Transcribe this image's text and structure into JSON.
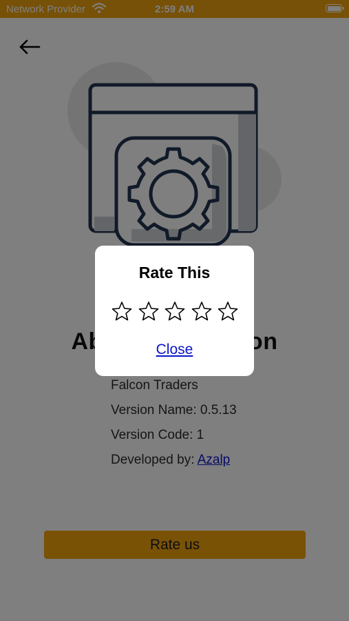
{
  "status_bar": {
    "carrier": "Network Provider",
    "time": "2:59 AM",
    "wifi_icon": "wifi-icon",
    "battery_icon": "battery-icon"
  },
  "header": {
    "back_icon": "arrow-left-icon"
  },
  "about": {
    "illustration_icon": "app-settings-gear-icon",
    "title": "About Application",
    "company": "Falcon Traders",
    "version_name": "Version Name: 0.5.13",
    "version_code": "Version Code: 1",
    "developer_prefix": "Developed by: ",
    "developer_link": "Azalp"
  },
  "rate_button": {
    "label": "Rate us"
  },
  "dialog": {
    "title": "Rate This",
    "star_icon": "star-outline-icon",
    "stars_total": 5,
    "stars_selected": 0,
    "close_label": "Close"
  },
  "colors": {
    "accent": "#f2a40d",
    "link": "#0a13c8",
    "illustration_stroke": "#233550",
    "overlay": "rgba(0,0,0,0.5)"
  }
}
